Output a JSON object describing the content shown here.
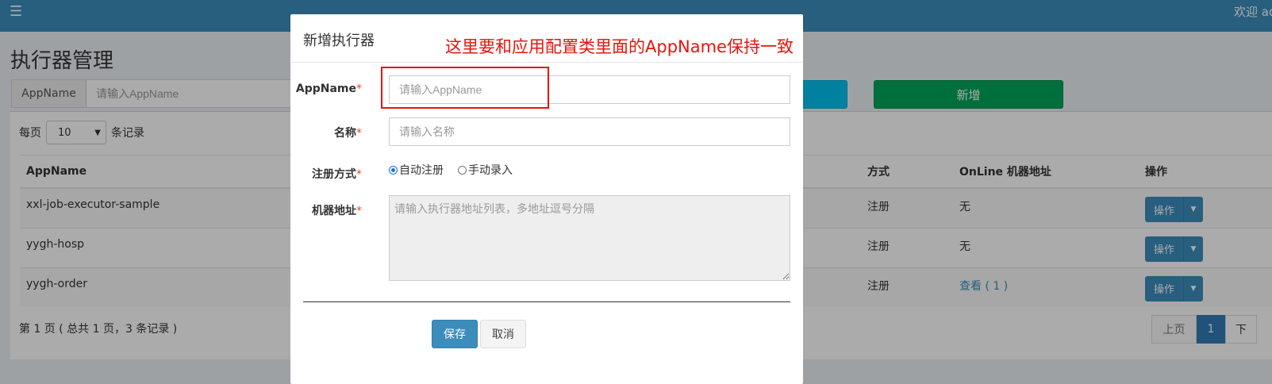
{
  "header": {
    "menu_icon": "menu-icon",
    "welcome": "欢迎 ad"
  },
  "page": {
    "title": "执行器管理"
  },
  "search": {
    "label": "AppName",
    "placeholder": "请输入AppName"
  },
  "toolbar": {
    "add_label": "新增"
  },
  "perpage": {
    "prefix": "每页",
    "value": "10",
    "suffix": "条记录"
  },
  "table": {
    "headers": [
      "AppName",
      "",
      "方式",
      "OnLine 机器地址",
      "操作"
    ],
    "rows": [
      {
        "appname": "xxl-job-executor-sample",
        "method": "注册",
        "online": "无",
        "op": "操作"
      },
      {
        "appname": "yygh-hosp",
        "method": "注册",
        "online": "无",
        "op": "操作"
      },
      {
        "appname": "yygh-order",
        "method": "注册",
        "online": "查看 ( 1 )",
        "op": "操作"
      }
    ]
  },
  "pagination": {
    "summary": "第 1 页 ( 总共 1 页，3 条记录 )",
    "prev": "上页",
    "current": "1",
    "next": "下"
  },
  "modal": {
    "title": "新增执行器",
    "annotation": "这里要和应用配置类里面的AppName保持一致",
    "fields": {
      "appname": {
        "label": "AppName",
        "placeholder": "请输入AppName"
      },
      "name": {
        "label": "名称",
        "placeholder": "请输入名称"
      },
      "register": {
        "label": "注册方式",
        "options": [
          "自动注册",
          "手动录入"
        ],
        "selected": "自动注册"
      },
      "address": {
        "label": "机器地址",
        "placeholder": "请输入执行器地址列表，多地址逗号分隔"
      }
    },
    "required_mark": "*",
    "save_label": "保存",
    "cancel_label": "取消"
  },
  "colors": {
    "header": "#3c8dbc",
    "primary": "#3c8dbc",
    "success": "#00a65a",
    "info": "#00c0ef",
    "annotation": "#e8140c"
  }
}
